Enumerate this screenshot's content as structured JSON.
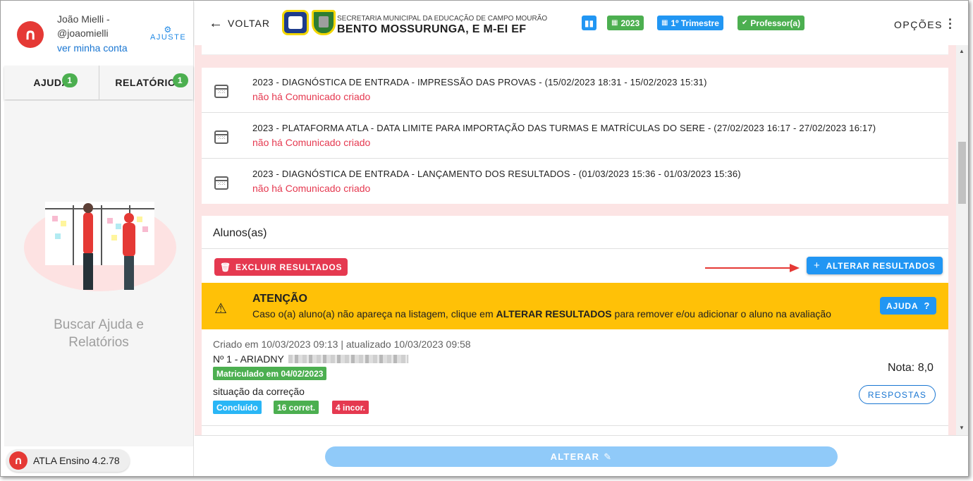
{
  "user": {
    "name": "João Mielli -",
    "handle": "@joaomielli",
    "account_link": "ver minha conta",
    "settings_label": "AJUSTE"
  },
  "sidebar": {
    "tabs": [
      {
        "label": "AJUDA",
        "badge": "1"
      },
      {
        "label": "RELATÓRIOS",
        "badge": "1"
      }
    ],
    "help_text_line1": "Buscar Ajuda e",
    "help_text_line2": "Relatórios",
    "version": "ATLA Ensino 4.2.78"
  },
  "header": {
    "back_label": "VOLTAR",
    "school_subtitle": "SECRETARIA MUNICIPAL DA EDUCAÇÃO DE CAMPO MOURÃO",
    "school_name": "BENTO MOSSURUNGA, E M-EI EF",
    "chips": [
      {
        "label": "",
        "icon": "bar-chart-icon",
        "color": "#2196f3"
      },
      {
        "label": "2023",
        "icon": "calendar-icon",
        "color": "#4caf50"
      },
      {
        "label": "1º Trimestre",
        "icon": "calendar-icon",
        "color": "#2196f3"
      },
      {
        "label": "Professor(a)",
        "icon": "check-circle-icon",
        "color": "#4caf50"
      }
    ],
    "options_label": "OPÇÕES"
  },
  "events": [
    {
      "title": "2023 - DIAGNÓSTICA DE ENTRADA - IMPRESSÃO DAS PROVAS - (15/02/2023 18:31 - 15/02/2023 15:31)",
      "status": "não há Comunicado criado"
    },
    {
      "title": "2023 - PLATAFORMA ATLA - DATA LIMITE PARA IMPORTAÇÃO DAS TURMAS E MATRÍCULAS DO SERE - (27/02/2023 16:17 - 27/02/2023 16:17)",
      "status": "não há Comunicado criado"
    },
    {
      "title": "2023 - DIAGNÓSTICA DE ENTRADA - LANÇAMENTO DOS RESULTADOS - (01/03/2023 15:36 - 01/03/2023 15:36)",
      "status": "não há Comunicado criado"
    }
  ],
  "students": {
    "heading": "Alunos(as)",
    "delete_label": "EXCLUIR RESULTADOS",
    "change_label": "ALTERAR RESULTADOS",
    "alert": {
      "title": "ATENÇÃO",
      "message_pre": "Caso o(a) aluno(a) não apareça na listagem, clique em ",
      "message_bold": "ALTERAR RESULTADOS",
      "message_post": " para remover e/ou adicionar o aluno na avaliação",
      "help_label": "AJUDA"
    },
    "item": {
      "created": "Criado em 10/03/2023 09:13 | atualizado 10/03/2023 09:58",
      "name": "Nº 1 - ARIADNY",
      "enrolled": "Matriculado em 04/02/2023",
      "correction_label": "situação da correção",
      "tags": [
        {
          "label": "Concluído",
          "color": "#29b6f6"
        },
        {
          "label": "16 corret.",
          "color": "#4caf50"
        },
        {
          "label": "4 incor.",
          "color": "#e53950"
        }
      ],
      "grade": "Nota: 8,0",
      "answers_label": "RESPOSTAS"
    }
  },
  "footer": {
    "submit_label": "ALTERAR"
  }
}
